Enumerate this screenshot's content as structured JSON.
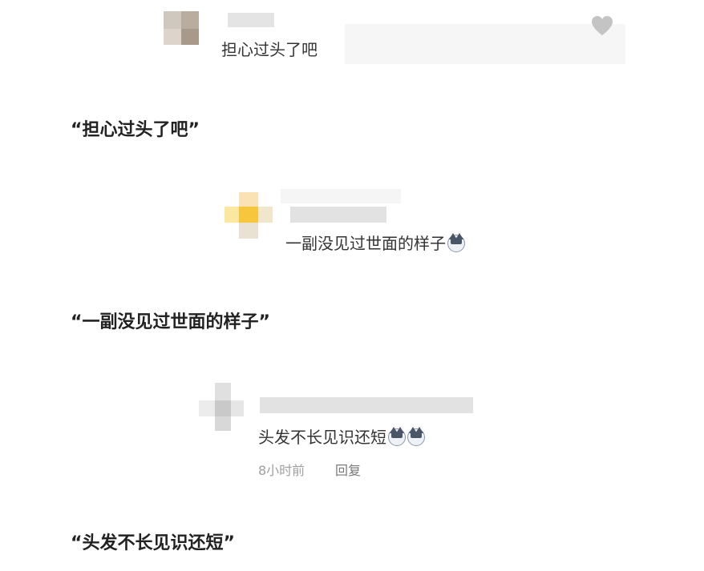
{
  "comments": [
    {
      "text": "担心过头了吧",
      "emojis": []
    },
    {
      "text": "一副没见过世面的样子",
      "emojis": [
        "cat-emoji"
      ]
    },
    {
      "text": "头发不长见识还短",
      "emojis": [
        "cat-emoji",
        "cat-emoji"
      ],
      "time": "8小时前",
      "reply_label": "回复"
    }
  ],
  "captions": [
    "“担心过头了吧”",
    "“一副没见过世面的样子”",
    "“头发不长见识还短”"
  ],
  "icons": {
    "like": "heart-icon",
    "emoji": "cat-face-emoji-icon"
  },
  "colors": {
    "text": "#333333",
    "caption": "#222222",
    "meta": "#8a8a8a",
    "heart": "#c4c4c4"
  }
}
